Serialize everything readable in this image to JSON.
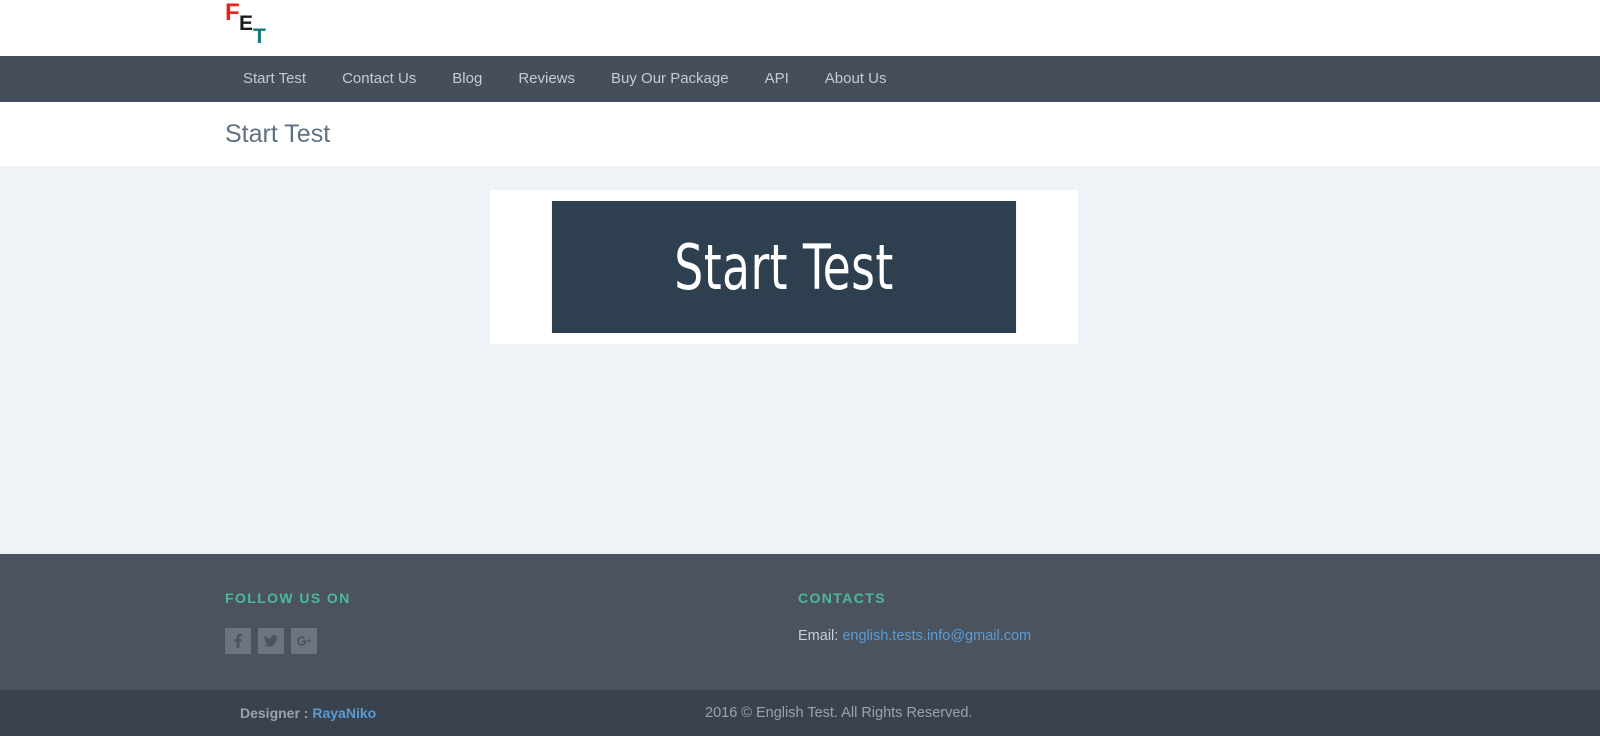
{
  "header": {
    "logo": {
      "letter_1": "F",
      "letter_2": "E",
      "letter_3": "T",
      "color_1": "#e8211c",
      "color_2": "#1c1c1c",
      "color_3": "#147a7a"
    }
  },
  "nav": {
    "items": [
      {
        "label": "Start Test"
      },
      {
        "label": "Contact Us"
      },
      {
        "label": "Blog"
      },
      {
        "label": "Reviews"
      },
      {
        "label": "Buy Our Package"
      },
      {
        "label": "API"
      },
      {
        "label": "About Us"
      }
    ]
  },
  "page": {
    "title": "Start Test"
  },
  "main": {
    "start_button_label": "Start Test",
    "button_bg": "#2e3f50",
    "card_bg": "#ffffff",
    "content_bg": "#eff2f6"
  },
  "footer": {
    "follow": {
      "heading": "FOLLOW US ON",
      "socials": [
        {
          "name": "facebook-icon",
          "label": "Facebook"
        },
        {
          "name": "twitter-icon",
          "label": "Twitter"
        },
        {
          "name": "google-plus-icon",
          "label": "Google Plus"
        }
      ]
    },
    "contacts": {
      "heading": "CONTACTS",
      "email_label": "Email:",
      "email_value": "english.tests.info@gmail.com"
    },
    "heading_color": "#4cb99a",
    "bg": "#4a535e"
  },
  "bottom_bar": {
    "designer_label": "Designer :",
    "designer_name": "RayaNiko",
    "copyright": "2016 © English Test. All Rights Reserved.",
    "bg": "#3a424d"
  }
}
